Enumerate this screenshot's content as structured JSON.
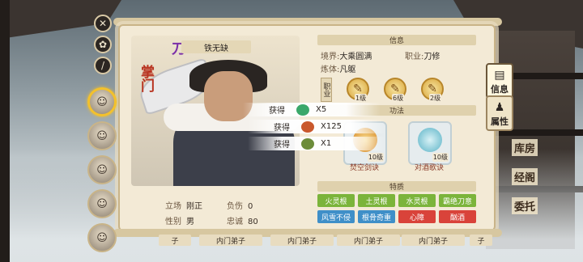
{
  "character": {
    "name": "铁无缺",
    "title_vertical": "掌门",
    "title_icon": "刀",
    "stats": {
      "stance_label": "立场",
      "stance_value": "刚正",
      "injury_label": "负伤",
      "injury_value": "0",
      "gender_label": "性别",
      "gender_value": "男",
      "loyalty_label": "忠诚",
      "loyalty_value": "80"
    }
  },
  "info": {
    "header": "信息",
    "realm_label": "境界:",
    "realm_value": "大乘圆满",
    "job_label": "职业:",
    "job_value": "刀修",
    "body_label": "炼体:",
    "body_value": "凡躯",
    "job_tag": "职业",
    "job_skills": [
      {
        "level": "1级"
      },
      {
        "level": "6级"
      },
      {
        "level": "2级"
      }
    ]
  },
  "arts": {
    "header": "功法",
    "items": [
      {
        "name": "焚空剑诀",
        "level": "10级"
      },
      {
        "name": "对酒歌诀",
        "level": "10级"
      }
    ]
  },
  "traits": {
    "header": "特质",
    "items": [
      {
        "label": "火灵根",
        "color": "#7bb43b"
      },
      {
        "label": "土灵根",
        "color": "#7bb43b"
      },
      {
        "label": "水灵根",
        "color": "#7bb43b"
      },
      {
        "label": "霸绝刀意",
        "color": "#7bb43b"
      },
      {
        "label": "风雪不侵",
        "color": "#3f8fc8"
      },
      {
        "label": "根骨奇重",
        "color": "#3f8fc8"
      },
      {
        "label": "心障",
        "color": "#d9433a"
      },
      {
        "label": "酗酒",
        "color": "#d9433a"
      }
    ]
  },
  "rewards": [
    {
      "label": "获得",
      "count": "X5",
      "icon_color": "#3aa86a",
      "icon": "jade-icon"
    },
    {
      "label": "获得",
      "count": "X125",
      "icon_color": "#c9582c",
      "icon": "ore-icon"
    },
    {
      "label": "获得",
      "count": "X1",
      "icon_color": "#6c8c3a",
      "icon": "herb-icon"
    }
  ],
  "tabs": [
    {
      "label": "信息",
      "icon": "scroll-icon"
    },
    {
      "label": "属性",
      "icon": "body-icon"
    }
  ],
  "side_labels": [
    "库房",
    "经阁",
    "委托"
  ],
  "bottom_tabs": [
    "子",
    "内门弟子",
    "内门弟子",
    "内门弟子",
    "内门弟子",
    "子"
  ],
  "avatars": [
    "avatar-1",
    "avatar-2",
    "avatar-3",
    "avatar-4",
    "avatar-5"
  ]
}
